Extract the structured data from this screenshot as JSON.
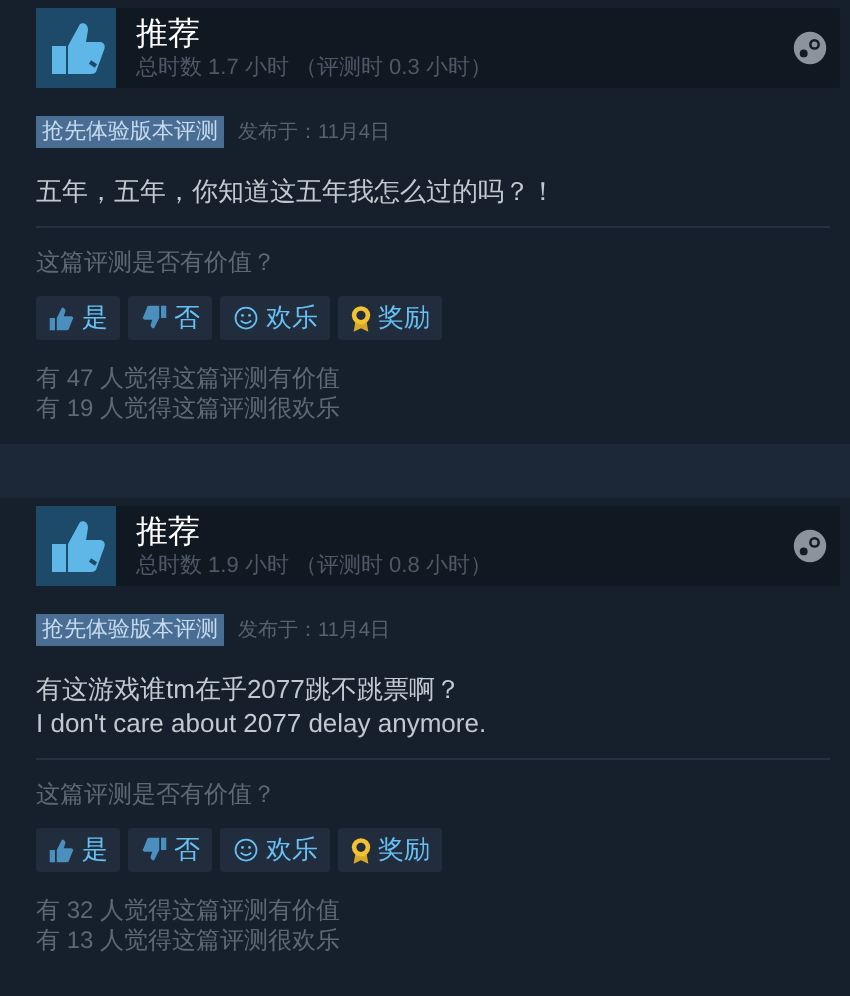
{
  "reviews": [
    {
      "verdict": "推荐",
      "hours": "总时数 1.7 小时 （评测时 0.3 小时）",
      "tag": "抢先体验版本评测",
      "posted": "发布于：11月4日",
      "body": [
        "五年，五年，你知道这五年我怎么过的吗？！"
      ],
      "question": "这篇评测是否有价值？",
      "buttons": [
        {
          "kind": "yes",
          "label": "是"
        },
        {
          "kind": "no",
          "label": "否"
        },
        {
          "kind": "funny",
          "label": "欢乐"
        },
        {
          "kind": "award",
          "label": "奖励"
        }
      ],
      "stats": [
        "有 47 人觉得这篇评测有价值",
        "有 19 人觉得这篇评测很欢乐"
      ]
    },
    {
      "verdict": "推荐",
      "hours": "总时数 1.9 小时 （评测时 0.8 小时）",
      "tag": "抢先体验版本评测",
      "posted": "发布于：11月4日",
      "body": [
        "有这游戏谁tm在乎2077跳不跳票啊？",
        "I don't care about 2077 delay anymore."
      ],
      "question": "这篇评测是否有价值？",
      "buttons": [
        {
          "kind": "yes",
          "label": "是"
        },
        {
          "kind": "no",
          "label": "否"
        },
        {
          "kind": "funny",
          "label": "欢乐"
        },
        {
          "kind": "award",
          "label": "奖励"
        }
      ],
      "stats": [
        "有 32 人觉得这篇评测有价值",
        "有 13 人觉得这篇评测很欢乐"
      ]
    }
  ]
}
